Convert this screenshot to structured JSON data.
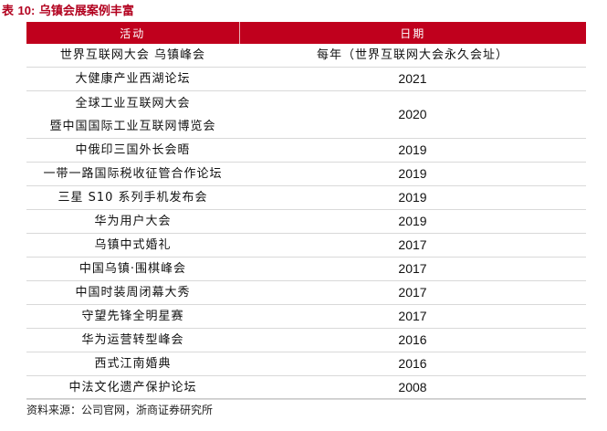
{
  "title": {
    "prefix": "表",
    "number": "10:",
    "text": "乌镇会展案例丰富"
  },
  "table": {
    "headers": [
      "活动",
      "日期"
    ],
    "rows": [
      {
        "activity": [
          "世界互联网大会 乌镇峰会"
        ],
        "date": "每年（世界互联网大会永久会址）"
      },
      {
        "activity": [
          "大健康产业西湖论坛"
        ],
        "date": "2021"
      },
      {
        "activity": [
          "全球工业互联网大会",
          "暨中国国际工业互联网博览会"
        ],
        "date": "2020"
      },
      {
        "activity": [
          "中俄印三国外长会晤"
        ],
        "date": "2019"
      },
      {
        "activity": [
          "一带一路国际税收征管合作论坛"
        ],
        "date": "2019"
      },
      {
        "activity": [
          "三星 S10 系列手机发布会"
        ],
        "date": "2019"
      },
      {
        "activity": [
          "华为用户大会"
        ],
        "date": "2019"
      },
      {
        "activity": [
          "乌镇中式婚礼"
        ],
        "date": "2017"
      },
      {
        "activity": [
          "中国乌镇·围棋峰会"
        ],
        "date": "2017"
      },
      {
        "activity": [
          "中国时装周闭幕大秀"
        ],
        "date": "2017"
      },
      {
        "activity": [
          "守望先锋全明星赛"
        ],
        "date": "2017"
      },
      {
        "activity": [
          "华为运营转型峰会"
        ],
        "date": "2016"
      },
      {
        "activity": [
          "西式江南婚典"
        ],
        "date": "2016"
      },
      {
        "activity": [
          "中法文化遗产保护论坛"
        ],
        "date": "2008"
      }
    ]
  },
  "source": "资料来源：公司官网，浙商证券研究所"
}
